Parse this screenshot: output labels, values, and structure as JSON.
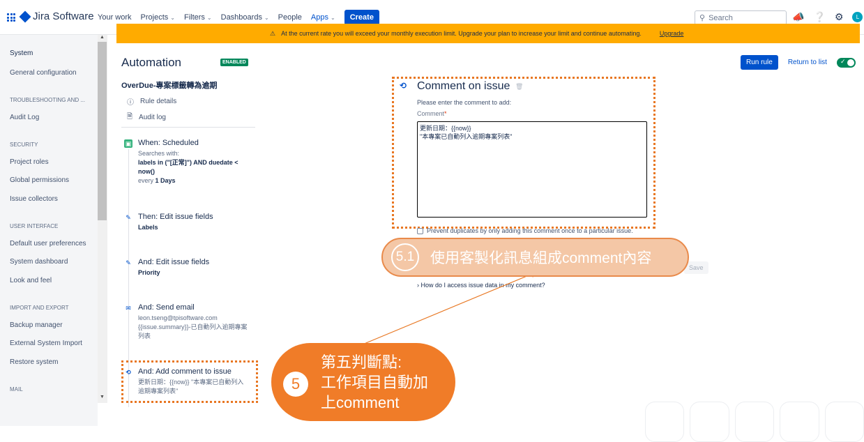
{
  "nav": {
    "product": "Jira Software",
    "items": [
      "Your work",
      "Projects",
      "Filters",
      "Dashboards",
      "People",
      "Apps"
    ],
    "create": "Create",
    "search_placeholder": "Search",
    "avatar_letter": "L"
  },
  "banner": {
    "text": "At the current rate you will exceed your monthly execution limit. Upgrade your plan to increase your limit and continue automating.",
    "link": "Upgrade"
  },
  "sidebar": {
    "system": "System",
    "general": "General configuration",
    "h_troubleshoot": "TROUBLESHOOTING AND ...",
    "audit": "Audit Log",
    "h_security": "SECURITY",
    "project_roles": "Project roles",
    "global_perms": "Global permissions",
    "issue_collectors": "Issue collectors",
    "h_ui": "USER INTERFACE",
    "default_prefs": "Default user preferences",
    "sys_dashboard": "System dashboard",
    "look_feel": "Look and feel",
    "h_import": "IMPORT AND EXPORT",
    "backup": "Backup manager",
    "ext_import": "External System Import",
    "restore": "Restore system",
    "h_mail": "MAIL"
  },
  "rule": {
    "page_title": "Automation",
    "status": "ENABLED",
    "name": "OverDue-專案標籤轉為逾期",
    "details": "Rule details",
    "audit": "Audit log"
  },
  "steps": {
    "s1_title": "When: Scheduled",
    "s1_sub1": "Searches with:",
    "s1_jql1": "labels in (\"[正常]\") AND duedate <",
    "s1_jql2": "now()",
    "s1_every": "every",
    "s1_days": "1 Days",
    "s2_title": "Then: Edit issue fields",
    "s2_sub": "Labels",
    "s3_title": "And: Edit issue fields",
    "s3_sub": "Priority",
    "s4_title": "And: Send email",
    "s4_sub1": "leon.tseng@tpisoftware.com",
    "s4_sub2": "{{issue.summary}}-已自動列入逾期專案",
    "s4_sub3": "列表",
    "s5_title": "And: Add comment to issue",
    "s5_sub1": "更新日期：{{now}} \"本專案已自動列入",
    "s5_sub2": "逾期專案列表\""
  },
  "panel": {
    "title": "Comment on issue",
    "prompt": "Please enter the comment to add:",
    "label": "Comment",
    "required": "*",
    "comment_text": "更新日期：{{now}}\n\"本專案已自動列入逾期專案列表\"",
    "prevent": "Prevent duplicates by only adding this comment once to a particular issue.",
    "save": "Save",
    "howto": "How do I access issue data in my comment?"
  },
  "actions": {
    "run": "Run rule",
    "return": "Return to list"
  },
  "callouts": {
    "c1_num": "5.1",
    "c1_text": "使用客製化訊息組成comment內容",
    "c2_num": "5",
    "c2_text": "第五判斷點:\n工作項目自動加\n上comment"
  },
  "colors": {
    "accent": "#0052cc",
    "banner": "#ffab00",
    "callout": "#f07c28",
    "enabled": "#00875a"
  }
}
